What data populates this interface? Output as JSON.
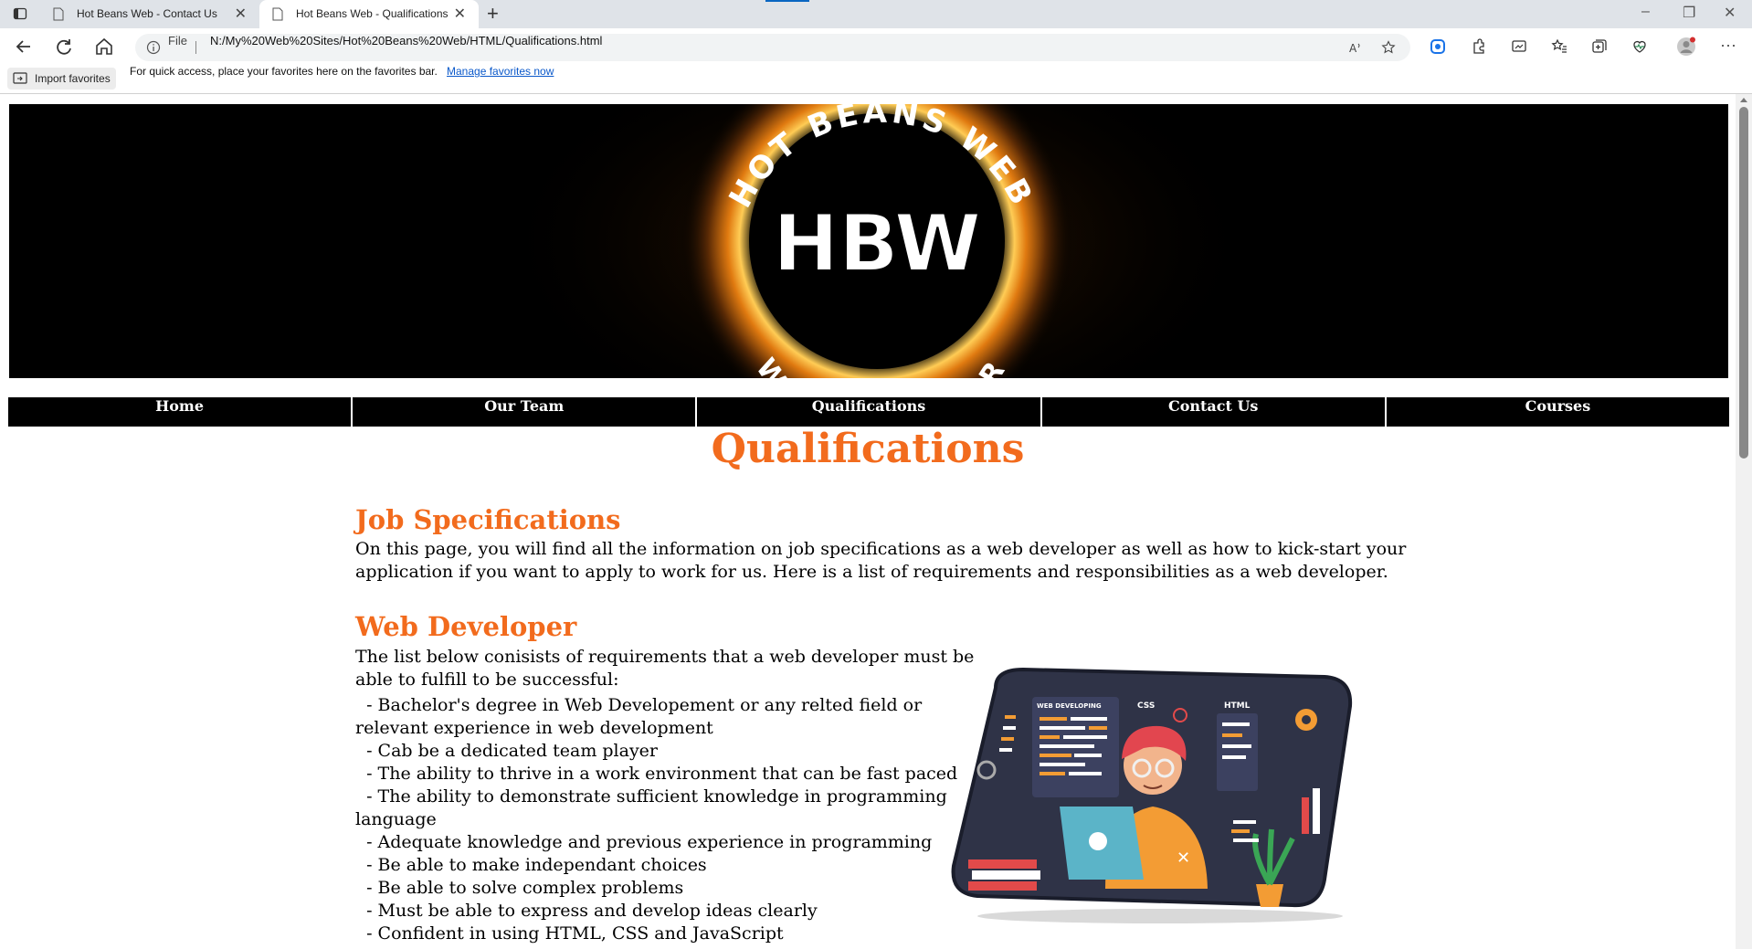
{
  "browser": {
    "tabs": [
      {
        "title": "Hot Beans Web - Contact Us",
        "active": false
      },
      {
        "title": "Hot Beans Web - Qualifications",
        "active": true
      }
    ],
    "address": {
      "scheme_label": "File",
      "url": "N:/My%20Web%20Sites/Hot%20Beans%20Web/HTML/Qualifications.html"
    },
    "favorites_bar": {
      "import_label": "Import favorites",
      "message": "For quick access, place your favorites here on the favorites bar.",
      "link": "Manage favorites now"
    }
  },
  "banner": {
    "logo_ring_top": "HOT BEANS WEB",
    "logo_ring_bottom": "WEB DEVELOPER",
    "logo_initials": "HBW"
  },
  "nav": {
    "items": [
      "Home",
      "Our Team",
      "Qualifications",
      "Contact Us",
      "Courses"
    ]
  },
  "page": {
    "title": "Qualifications",
    "job_spec": {
      "heading": "Job Specifications",
      "line1": "On this page, you will find all the information on job specifications as a web developer as well as how to kick-start your",
      "line2": "application if you want to apply to work for us. Here is a list of requirements and responsibilities as a web developer."
    },
    "web_dev": {
      "heading": "Web Developer",
      "intro1": "The list below conisists of requirements that a web developer must be",
      "intro2": "able to fulfill to be successful:",
      "requirements": [
        "  - Bachelor's degree in Web Developement or any relted field or",
        "relevant experience in web development",
        "  - Cab be a dedicated team player",
        "  - The ability to thrive in a work environment that can be fast paced",
        "  - The ability to demonstrate sufficient knowledge in programming",
        "language",
        "  - Adequate knowledge and previous experience in programming",
        "  - Be able to make independant choices",
        "  - Be able to solve complex problems",
        "  - Must be able to express and develop ideas clearly",
        "  - Confident in using HTML, CSS and JavaScript"
      ]
    },
    "illustration": {
      "label_web": "WEB DEVELOPING",
      "label_css": "CSS",
      "label_html": "HTML"
    }
  },
  "colors": {
    "accent": "#f26b1d",
    "nav_bg": "#000000",
    "nav_text": "#ffffff"
  }
}
